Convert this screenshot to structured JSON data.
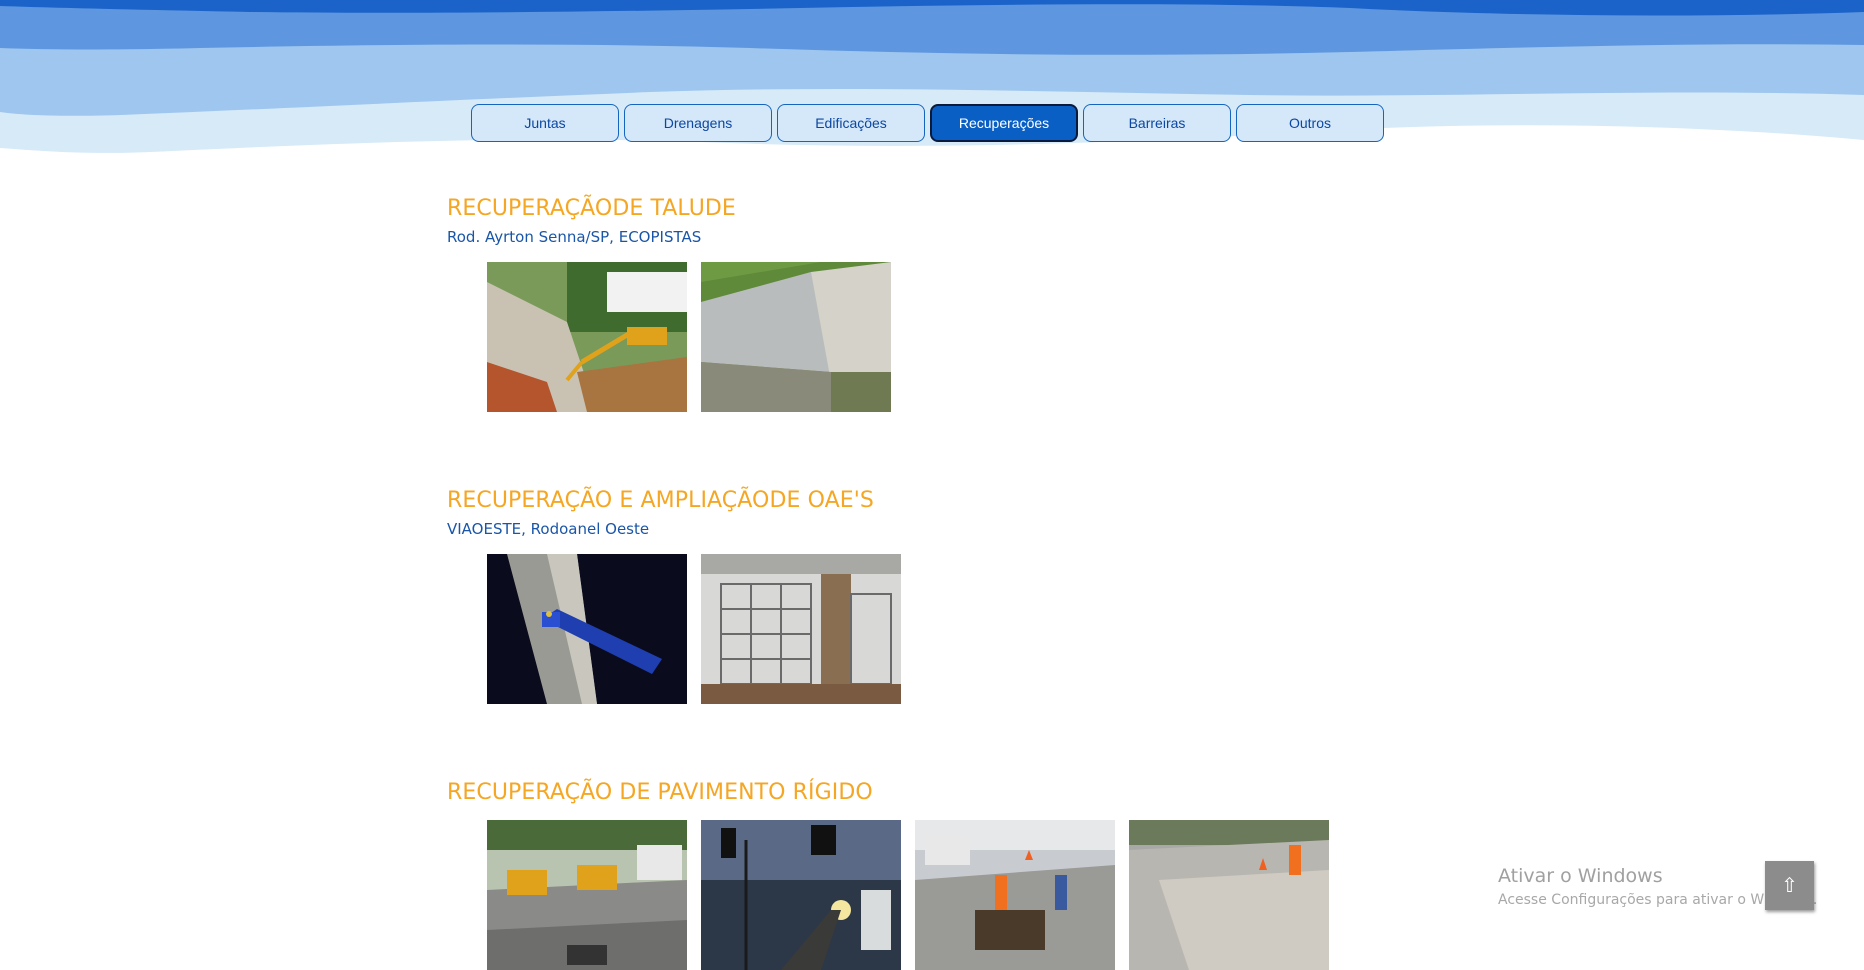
{
  "nav": {
    "tabs": [
      {
        "label": "Juntas"
      },
      {
        "label": "Drenagens"
      },
      {
        "label": "Edificações"
      },
      {
        "label": "Recuperações"
      },
      {
        "label": "Barreiras"
      },
      {
        "label": "Outros"
      }
    ],
    "active_tab": "Recuperações"
  },
  "sections": [
    {
      "title": "RECUPERAÇÃODE TALUDE",
      "subtitle": "Rod. Ayrton Senna/SP, ECOPISTAS"
    },
    {
      "title": "RECUPERAÇÃO E AMPLIAÇÃODE OAE'S",
      "subtitle": "VIAOESTE, Rodoanel Oeste"
    },
    {
      "title": "RECUPERAÇÃO DE PAVIMENTO RÍGIDO",
      "subtitle": ""
    }
  ],
  "windows_watermark": {
    "title": "Ativar o Windows",
    "subtitle": "Acesse Configurações para ativar o Windows."
  },
  "scroll_top": {
    "icon": "⇧"
  },
  "colors": {
    "heading": "#f5a623",
    "subtitle": "#1a56a8",
    "tab_bg": "#d4e8f9",
    "tab_active_bg": "#0a5fc4"
  }
}
